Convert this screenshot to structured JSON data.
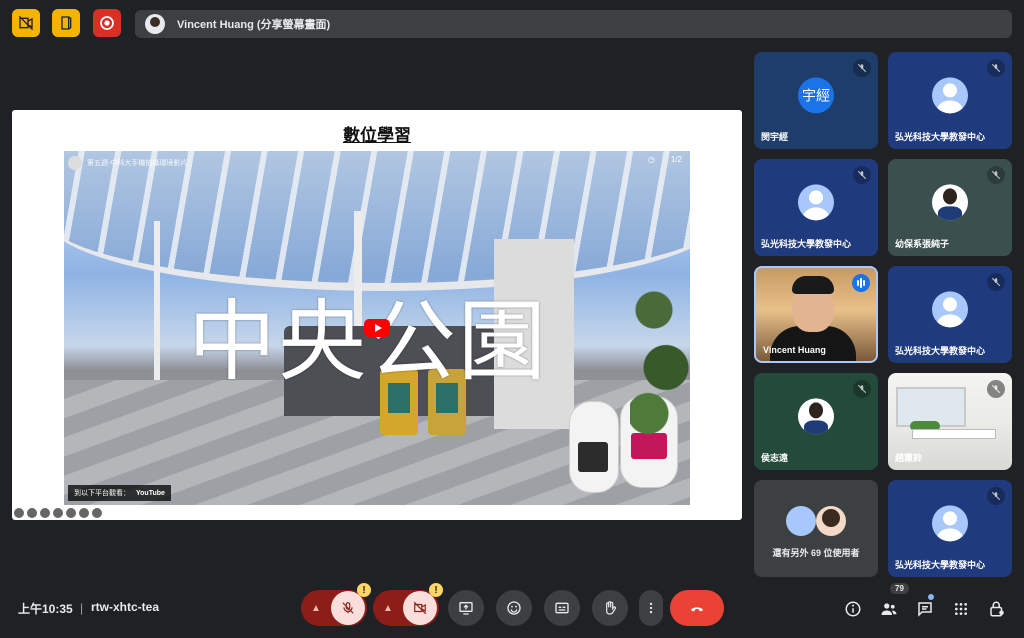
{
  "presenter": {
    "name": "Vincent Huang (分享螢幕畫面)"
  },
  "slide": {
    "title": "數位學習",
    "video": {
      "channel_title": "第五週-中科大手機拍攝環境影片",
      "overlay_text": "中央公園",
      "watch_on": "到以下平台觀看：",
      "platform": "YouTube",
      "counter": "1/2"
    }
  },
  "participants": [
    {
      "name": "閔宇經",
      "avatar": "letters",
      "initials": "宇經",
      "muted": true,
      "bg": "#1e3d6b"
    },
    {
      "name": "弘光科技大學教發中心",
      "avatar": "generic",
      "muted": true,
      "bg": "#1f3a7d"
    },
    {
      "name": "弘光科技大學教發中心",
      "avatar": "generic",
      "muted": true,
      "bg": "#1f3a7d"
    },
    {
      "name": "幼保系張純子",
      "avatar": "photo",
      "muted": true,
      "bg": "#3b4f4f"
    },
    {
      "name": "Vincent Huang",
      "avatar": "video",
      "muted": false,
      "speaking": true
    },
    {
      "name": "弘光科技大學教發中心",
      "avatar": "generic",
      "muted": true,
      "bg": "#1f3a7d"
    },
    {
      "name": "侯志遠",
      "avatar": "photo",
      "muted": true,
      "bg": "#234a3a"
    },
    {
      "name": "趙蕙鈴",
      "avatar": "room",
      "muted": true
    },
    {
      "more_text": "還有另外 69 位使用者"
    },
    {
      "name": "弘光科技大學教發中心",
      "avatar": "generic",
      "muted": true,
      "bg": "#1f3a7d"
    }
  ],
  "bottom_bar": {
    "time": "上午10:35",
    "separator": "|",
    "meeting_code": "rtw-xhtc-tea",
    "participant_count": "79",
    "warning_mark": "!"
  },
  "colors": {
    "background": "#202124",
    "control": "#3c4043",
    "danger": "#ea4335",
    "accent": "#1a73e8",
    "tile_blue": "#1f3a7d"
  }
}
